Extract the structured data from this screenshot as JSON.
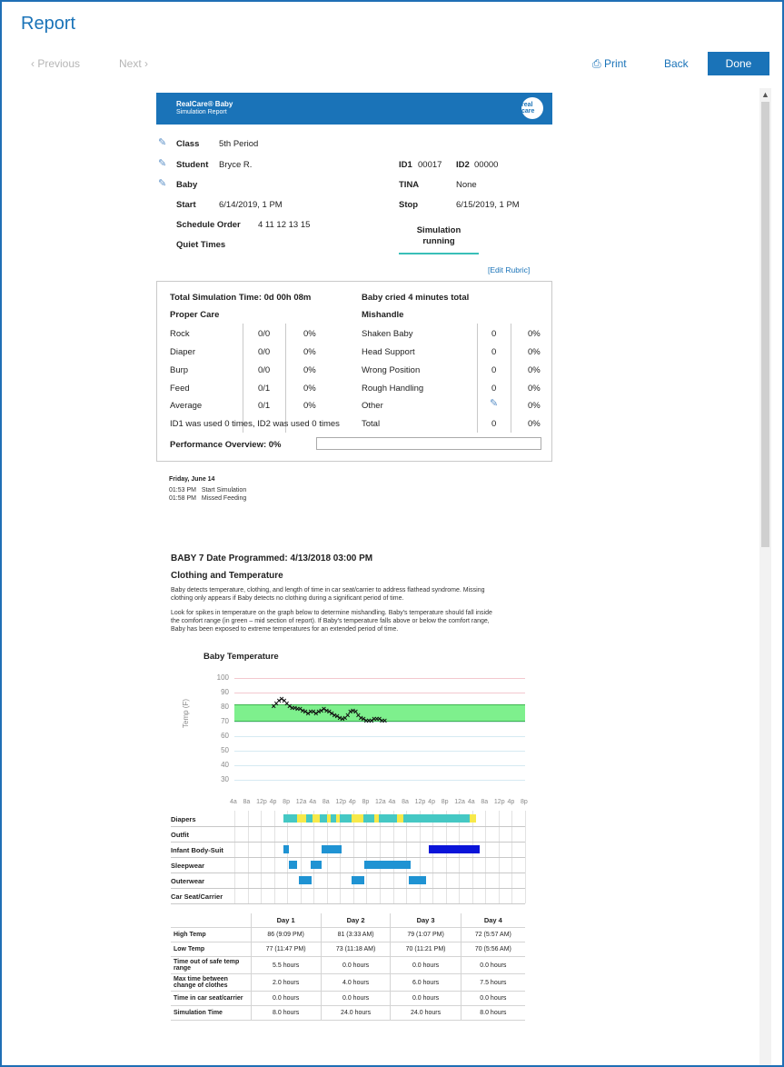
{
  "header": {
    "title": "Report",
    "previous_label": "Previous",
    "next_label": "Next",
    "print_label": "Print",
    "back_label": "Back",
    "done_label": "Done"
  },
  "report": {
    "banner_line1": "RealCare® Baby",
    "banner_line2": "Simulation Report",
    "logo_text": "real care",
    "class_label": "Class",
    "class_value": "5th Period",
    "student_label": "Student",
    "student_value": "Bryce R.",
    "baby_label": "Baby",
    "start_label": "Start",
    "start_value": "6/14/2019, 1 PM",
    "schedule_label": "Schedule Order",
    "schedule_value": "4 11 12 13 15",
    "quiet_label": "Quiet Times",
    "id1_label": "ID1",
    "id1_value": "00017",
    "id2_label": "ID2",
    "id2_value": "00000",
    "tina_label": "TINA",
    "tina_value": "None",
    "stop_label": "Stop",
    "stop_value": "6/15/2019, 1 PM",
    "status_line1": "Simulation",
    "status_line2": "running",
    "edit_rubric": "[Edit Rubric]"
  },
  "care": {
    "total_time": "Total Simulation Time: 0d 00h 08m",
    "cried": "Baby cried 4 minutes total",
    "proper_care": "Proper Care",
    "mishandle": "Mishandle",
    "proper_rows": [
      {
        "label": "Rock",
        "count": "0/0",
        "pct": "0%"
      },
      {
        "label": "Diaper",
        "count": "0/0",
        "pct": "0%"
      },
      {
        "label": "Burp",
        "count": "0/0",
        "pct": "0%"
      },
      {
        "label": "Feed",
        "count": "0/1",
        "pct": "0%"
      },
      {
        "label": "Average",
        "count": "0/1",
        "pct": "0%"
      }
    ],
    "mishandle_rows": [
      {
        "label": "Shaken Baby",
        "count": "0",
        "pct": "0%"
      },
      {
        "label": "Head Support",
        "count": "0",
        "pct": "0%"
      },
      {
        "label": "Wrong Position",
        "count": "0",
        "pct": "0%"
      },
      {
        "label": "Rough Handling",
        "count": "0",
        "pct": "0%"
      },
      {
        "label": "Other",
        "count": "",
        "pct": "0%"
      },
      {
        "label": "Total",
        "count": "0",
        "pct": "0%"
      }
    ],
    "id_usage": "ID1 was used 0 times, ID2 was used 0 times",
    "performance": "Performance Overview: 0%",
    "performance_value": 0
  },
  "log": {
    "date": "Friday, June 14",
    "entries": [
      {
        "time": "01:53 PM",
        "event": "Start Simulation"
      },
      {
        "time": "01:58 PM",
        "event": "Missed Feeding"
      }
    ]
  },
  "baby_section": {
    "heading": "BABY 7   Date Programmed: 4/13/2018 03:00 PM",
    "subheading": "Clothing and Temperature",
    "para1": "Baby detects temperature, clothing, and length of time in car seat/carrier to address flathead syndrome. Missing clothing only appears if Baby detects no clothing during a significant period of time.",
    "para2": "Look for spikes in temperature on the graph below to determine mishandling. Baby's temperature should fall inside the comfort range (in green – mid section of report). If Baby's temperature falls above or below the comfort range, Baby has been exposed to extreme temperatures for an extended period of time."
  },
  "chart_data": {
    "type": "scatter",
    "title": "Baby Temperature",
    "ylabel": "Temp (F)",
    "ylim": [
      30,
      100
    ],
    "yticks": [
      "100",
      "90",
      "80",
      "70",
      "60",
      "50",
      "40",
      "30"
    ],
    "comfort_range": [
      70,
      82
    ],
    "x_tick_labels": [
      "4a",
      "8a",
      "12p",
      "4p",
      "8p",
      "12a",
      "4a",
      "8a",
      "12p",
      "4p",
      "8p",
      "12a",
      "4a",
      "8a",
      "12p",
      "4p",
      "8p",
      "12a",
      "4a",
      "8a",
      "12p",
      "4p",
      "8p"
    ],
    "points": [
      [
        3.0,
        80
      ],
      [
        3.2,
        82
      ],
      [
        3.4,
        84
      ],
      [
        3.6,
        85
      ],
      [
        3.8,
        84
      ],
      [
        4.0,
        82
      ],
      [
        4.2,
        80
      ],
      [
        4.4,
        79
      ],
      [
        4.6,
        79
      ],
      [
        4.8,
        78
      ],
      [
        5.0,
        78
      ],
      [
        5.2,
        77
      ],
      [
        5.4,
        76
      ],
      [
        5.6,
        75
      ],
      [
        5.8,
        76
      ],
      [
        6.0,
        76
      ],
      [
        6.2,
        75
      ],
      [
        6.4,
        76
      ],
      [
        6.6,
        77
      ],
      [
        6.8,
        78
      ],
      [
        7.0,
        77
      ],
      [
        7.2,
        76
      ],
      [
        7.4,
        75
      ],
      [
        7.6,
        74
      ],
      [
        7.8,
        73
      ],
      [
        8.0,
        72
      ],
      [
        8.2,
        71
      ],
      [
        8.4,
        72
      ],
      [
        8.6,
        74
      ],
      [
        8.8,
        76
      ],
      [
        9.0,
        77
      ],
      [
        9.2,
        76
      ],
      [
        9.4,
        74
      ],
      [
        9.6,
        72
      ],
      [
        9.8,
        71
      ],
      [
        10.0,
        70
      ],
      [
        10.2,
        70
      ],
      [
        10.4,
        70
      ],
      [
        10.6,
        71
      ],
      [
        10.8,
        71
      ],
      [
        11.0,
        71
      ],
      [
        11.2,
        70
      ],
      [
        11.4,
        70
      ]
    ],
    "color": "#111111",
    "comfort_color": "#7ef08d"
  },
  "timeline": {
    "rows": [
      "Diapers",
      "Outfit",
      "Infant Body-Suit",
      "Sleepwear",
      "Outerwear",
      "Car Seat/Carrier"
    ],
    "colors": {
      "teal": "#45c8c4",
      "yellow": "#f7e94a",
      "blue": "#1f93d3",
      "navy": "#0a14d9"
    }
  },
  "stats": {
    "days": [
      "Day 1",
      "Day 2",
      "Day 3",
      "Day 4"
    ],
    "rows": [
      {
        "label": "High Temp",
        "values": [
          "86 (9:09 PM)",
          "81 (3:33 AM)",
          "79 (1:07 PM)",
          "72 (5:57 AM)"
        ]
      },
      {
        "label": "Low Temp",
        "values": [
          "77 (11:47 PM)",
          "73 (11:18 AM)",
          "70 (11:21 PM)",
          "70 (5:56 AM)"
        ]
      },
      {
        "label": "Time out of safe temp range",
        "values": [
          "5.5 hours",
          "0.0 hours",
          "0.0 hours",
          "0.0 hours"
        ]
      },
      {
        "label": "Max time between change of clothes",
        "values": [
          "2.0 hours",
          "4.0 hours",
          "6.0 hours",
          "7.5 hours"
        ]
      },
      {
        "label": "Time in car seat/carrier",
        "values": [
          "0.0 hours",
          "0.0 hours",
          "0.0 hours",
          "0.0 hours"
        ]
      },
      {
        "label": "Simulation Time",
        "values": [
          "8.0 hours",
          "24.0 hours",
          "24.0 hours",
          "8.0 hours"
        ]
      }
    ]
  }
}
